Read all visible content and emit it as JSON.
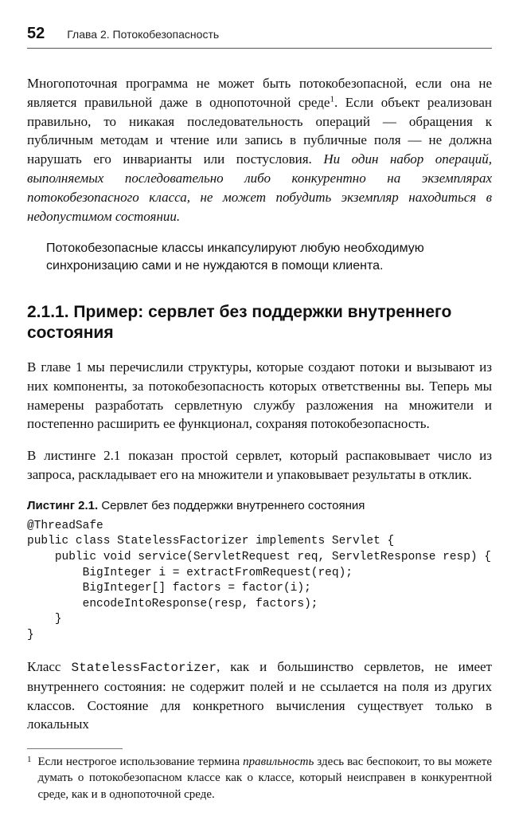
{
  "header": {
    "page_number": "52",
    "chapter": "Глава 2. Потокобезопасность"
  },
  "para1": {
    "part_a": "Многопоточная программа не может быть потокобезопасной, если она не является правильной даже в однопоточной среде",
    "sup": "1",
    "part_b": ". Если объект реализован правильно, то никакая последовательность операций — обращения к публичным методам и чтение или запись в публичные поля — не должна нарушать его инварианты или постусловия. ",
    "italic": "Ни один набор операций, выполняемых последовательно либо конкурентно на экземплярах потокобезопасного класса, не может побудить экземпляр находиться в недопустимом состоянии."
  },
  "callout1": "Потокобезопасные классы инкапсулируют любую необходимую синхронизацию сами и не нуждаются в помощи клиента.",
  "section_heading": "2.1.1. Пример: сервлет без поддержки внутреннего состояния",
  "para2": "В главе 1 мы перечислили структуры, которые создают потоки и вызывают из них компоненты, за потокобезопасность которых ответственны вы. Теперь мы намерены разработать сервлетную службу разложения на множители и постепенно расширить ее функционал, сохраняя потокобезопасность.",
  "para3": "В листинге 2.1 показан простой сервлет, который распаковывает число из запроса, раскладывает его на множители и упаковывает результаты в отклик.",
  "listing": {
    "label": "Листинг 2.1.",
    "caption": " Сервлет без поддержки внутреннего состояния",
    "code": "@ThreadSafe\npublic class StatelessFactorizer implements Servlet {\n    public void service(ServletRequest req, ServletResponse resp) {\n        BigInteger i = extractFromRequest(req);\n        BigInteger[] factors = factor(i);\n        encodeIntoResponse(resp, factors);\n    }\n}"
  },
  "para4": {
    "a": "Класс ",
    "code": "StatelessFactorizer",
    "b": ", как и большинство сервлетов, не имеет внутреннего состояния: не содержит полей и не ссылается на поля из других классов. Состояние для конкретного вычисления существует только в локальных"
  },
  "footnote": {
    "num": "1",
    "a": "Если нестрогое использование термина ",
    "i": "правильность",
    "b": " здесь вас беспокоит, то вы можете думать о потокобезопасном классе как о классе, который неисправен в конкурентной среде, как и в однопоточной среде."
  }
}
